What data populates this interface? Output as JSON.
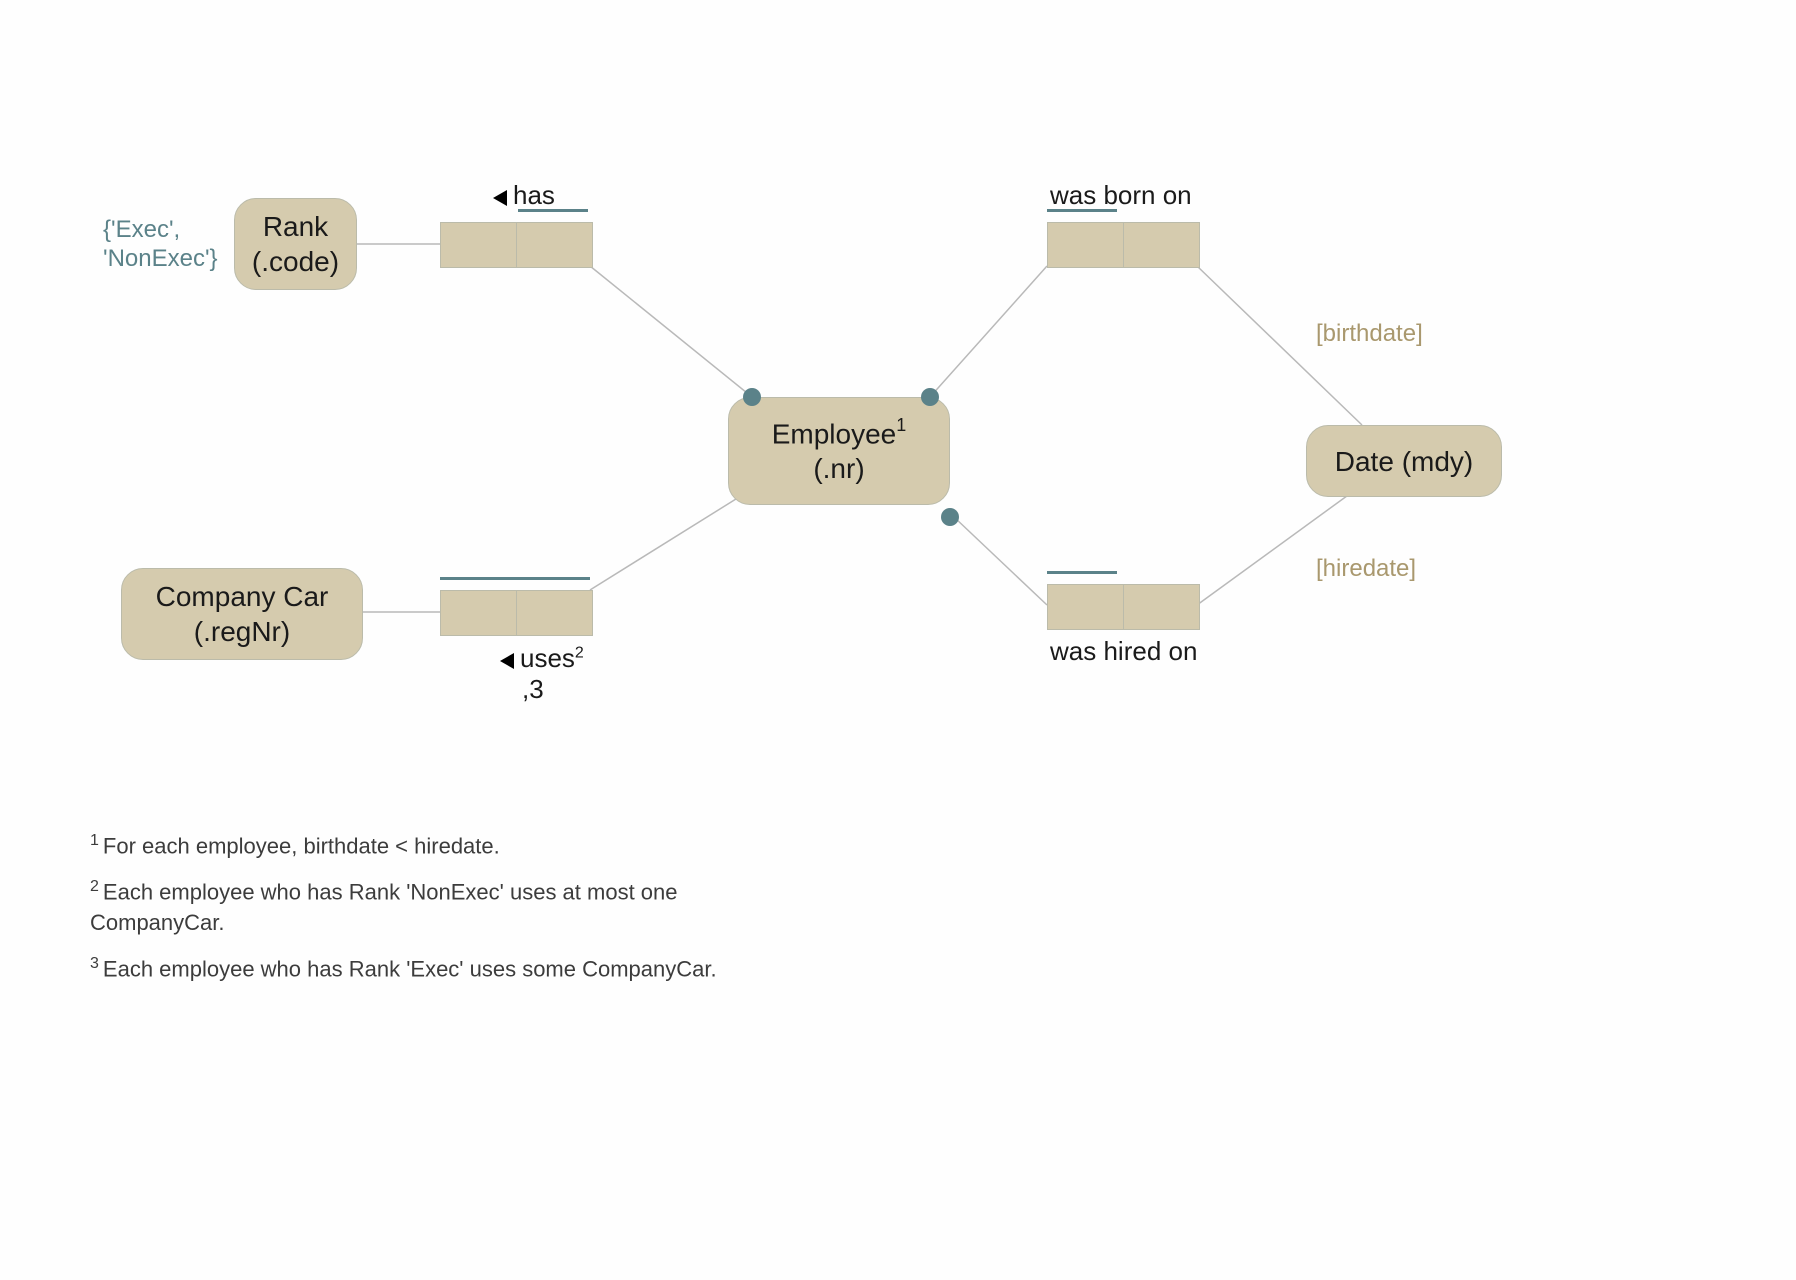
{
  "entities": {
    "rank": {
      "line1": "Rank",
      "line2": "(.code)"
    },
    "companyCar": {
      "line1": "Company Car",
      "line2": "(.regNr)"
    },
    "employee": {
      "line1_pre": "Employee",
      "line1_sup": "1",
      "line2": "(.nr)"
    },
    "date": {
      "line1": "Date (mdy)"
    }
  },
  "labels": {
    "has": "has",
    "uses_pre": "uses",
    "uses_sup1": "2",
    "uses_line2": ",3",
    "born": "was born on",
    "hired": "was hired on",
    "birthdate": "[birthdate]",
    "hiredate": "[hiredate]",
    "constraint_set_line1": "{'Exec',",
    "constraint_set_line2": "'NonExec'}"
  },
  "footnotes": {
    "n1": "For each employee, birthdate < hiredate.",
    "n2": "Each employee who has Rank 'NonExec' uses at most one CompanyCar.",
    "n3": "Each employee who has Rank 'Exec' uses some CompanyCar."
  }
}
